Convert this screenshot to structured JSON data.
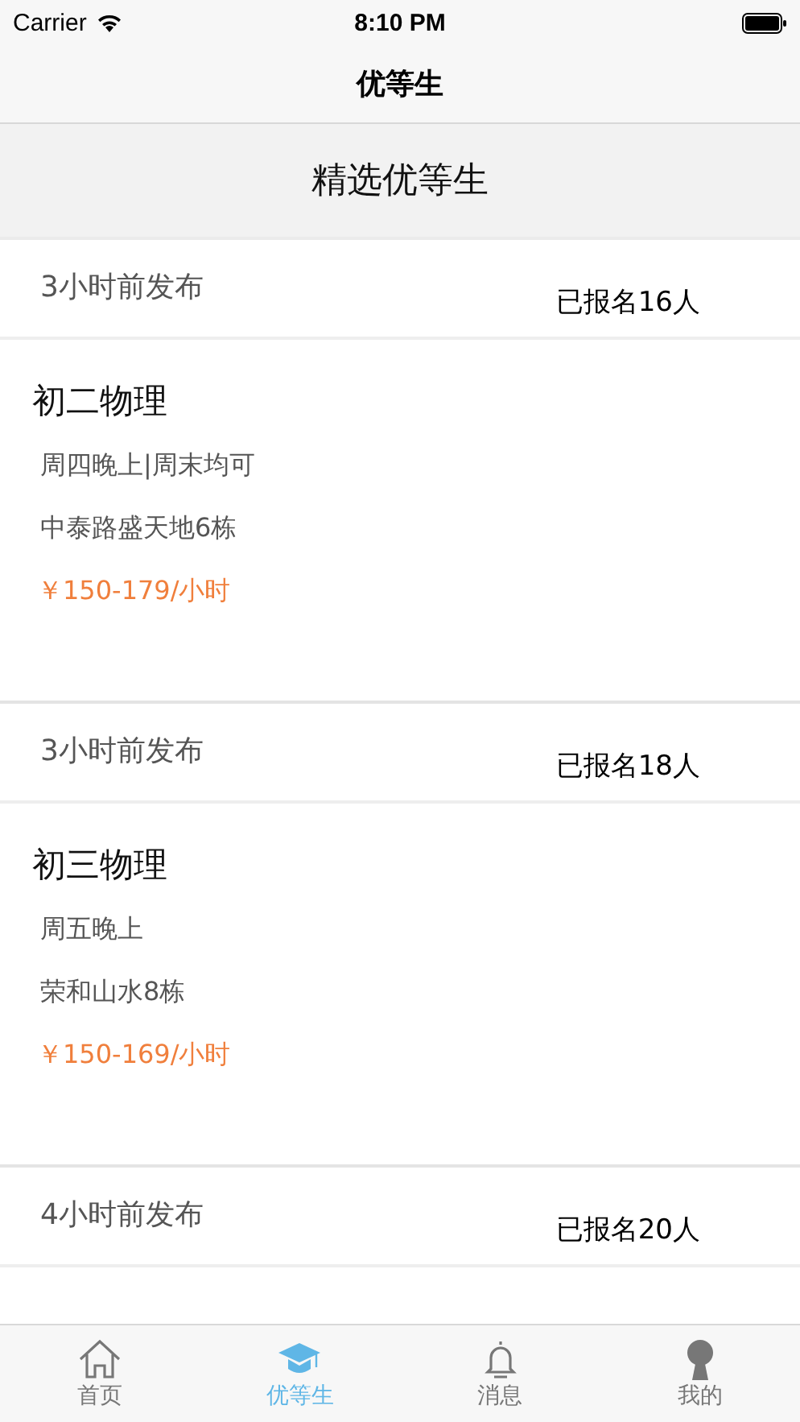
{
  "status_bar": {
    "carrier": "Carrier",
    "time": "8:10 PM"
  },
  "nav": {
    "title": "优等生"
  },
  "section": {
    "title": "精选优等生"
  },
  "posts": [
    {
      "posted": "3小时前发布",
      "signups": "已报名16人",
      "subject": "初二物理",
      "schedule": "周四晚上|周末均可",
      "address": "中泰路盛天地6栋",
      "price": "￥150-179/小时"
    },
    {
      "posted": "3小时前发布",
      "signups": "已报名18人",
      "subject": "初三物理",
      "schedule": "周五晚上",
      "address": "荣和山水8栋",
      "price": "￥150-169/小时"
    },
    {
      "posted": "4小时前发布",
      "signups": "已报名20人"
    }
  ],
  "tabs": [
    {
      "kind": "home",
      "label": "首页",
      "selected": false
    },
    {
      "kind": "cap",
      "label": "优等生",
      "selected": true
    },
    {
      "kind": "bell",
      "label": "消息",
      "selected": false
    },
    {
      "kind": "person",
      "label": "我的",
      "selected": false
    }
  ]
}
